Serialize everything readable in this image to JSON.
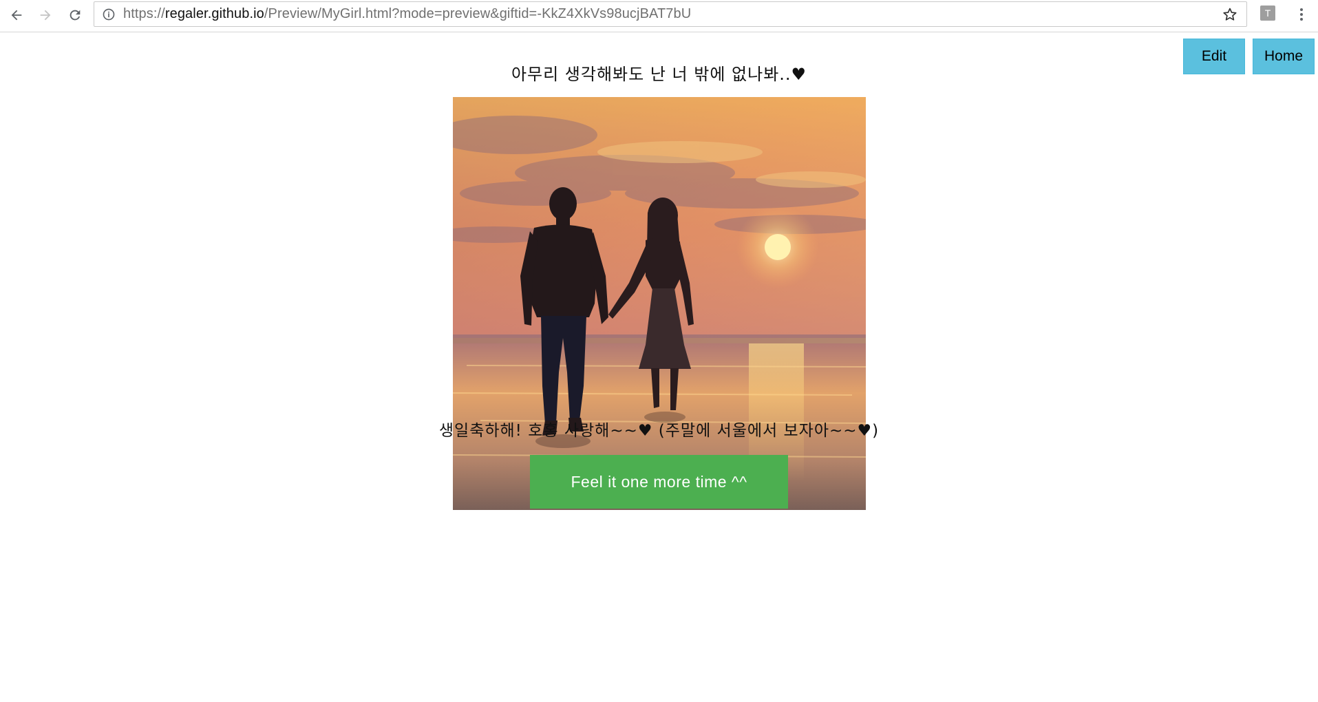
{
  "browser": {
    "url_scheme": "https://",
    "url_host": "regaler.github.io",
    "url_rest": "/Preview/MyGirl.html?mode=preview&giftid=-KkZ4XkVs98ucjBAT7bU",
    "extension_label": "T",
    "icons": {
      "back": "back-arrow-icon",
      "forward": "forward-arrow-icon",
      "reload": "reload-icon",
      "info": "info-icon",
      "star": "star-icon",
      "menu": "menu-dots-icon"
    }
  },
  "header": {
    "edit_label": "Edit",
    "home_label": "Home"
  },
  "content": {
    "headline": "아무리 생각해봐도 난 너 밖에 없나봐..♥",
    "message": "생일축하해! 호홍 사랑해~~♥ (주말에 서울에서 보자아~~♥)",
    "replay_label": "Feel it one more time ^^",
    "photo_subject": "couple holding hands on beach at sunset"
  },
  "colors": {
    "info_button": "#5bc0de",
    "replay_button": "#4caf50"
  }
}
